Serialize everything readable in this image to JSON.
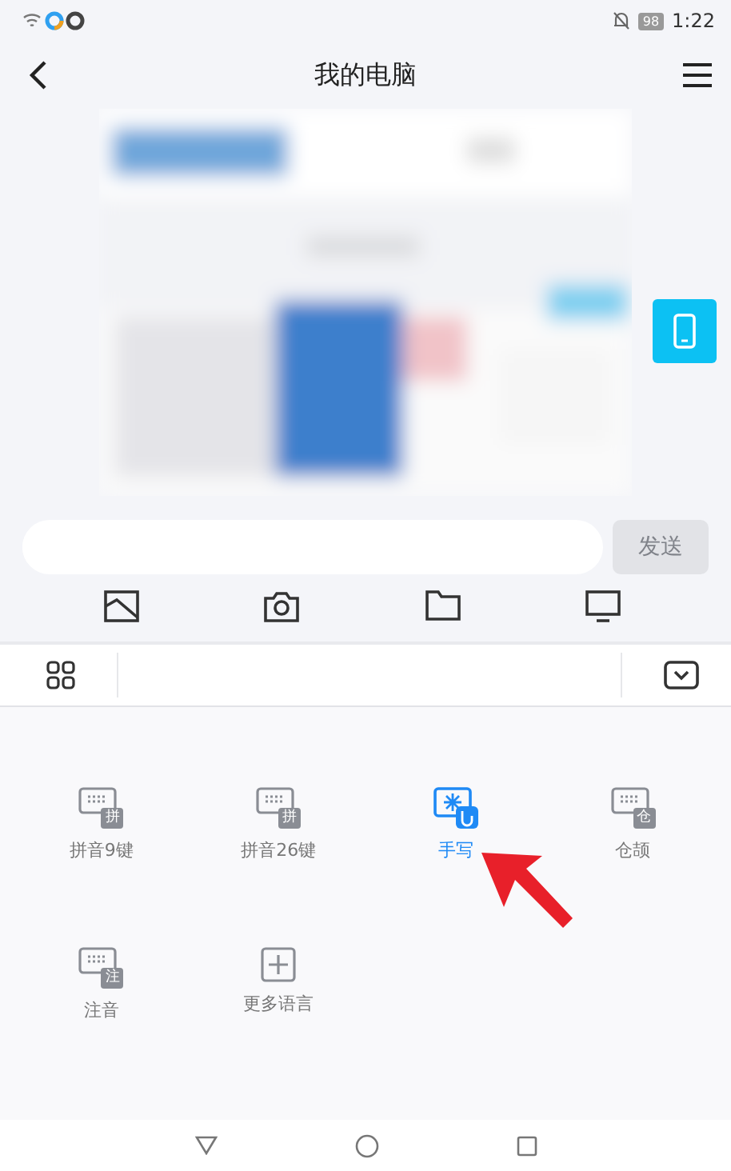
{
  "status_bar": {
    "battery": "98",
    "time": "1:22"
  },
  "header": {
    "title": "我的电脑"
  },
  "composer": {
    "send": "发送"
  },
  "input_methods": [
    {
      "kind": "keyboard",
      "badge": "拼",
      "label": "拼音9键",
      "selected": false
    },
    {
      "kind": "keyboard",
      "badge": "拼",
      "label": "拼音26键",
      "selected": false
    },
    {
      "kind": "handwriting",
      "label": "手写",
      "selected": true
    },
    {
      "kind": "keyboard",
      "badge": "仓",
      "label": "仓颉",
      "selected": false
    },
    {
      "kind": "keyboard",
      "badge": "注",
      "label": "注音",
      "selected": false
    },
    {
      "kind": "add",
      "label": "更多语言",
      "selected": false
    }
  ]
}
